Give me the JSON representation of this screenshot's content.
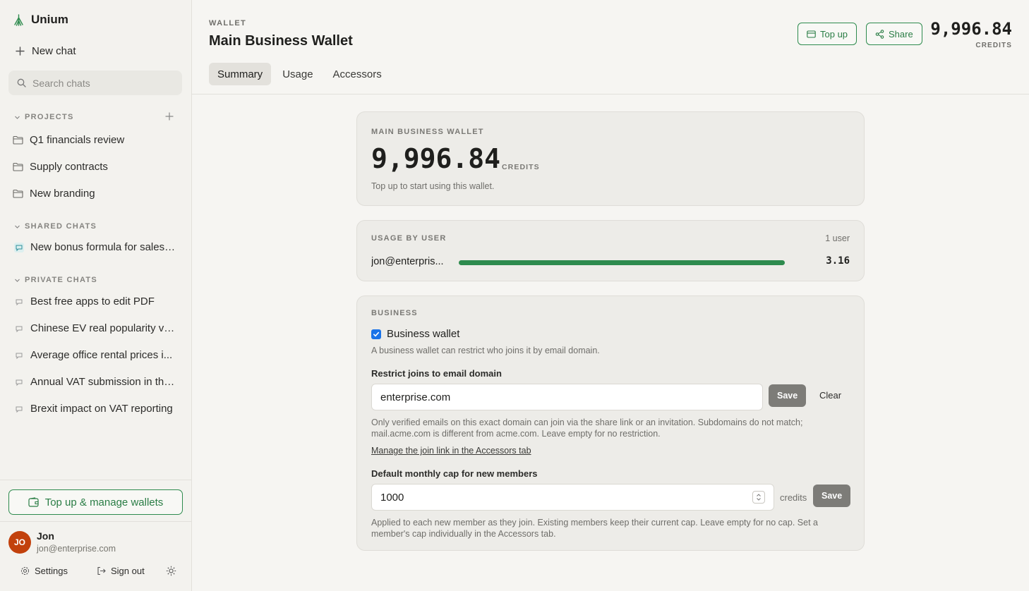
{
  "sidebar": {
    "brand": "Unium",
    "new_chat": "New chat",
    "search_placeholder": "Search chats",
    "projects_heading": "PROJECTS",
    "projects": [
      "Q1 financials review",
      "Supply contracts",
      "New branding"
    ],
    "shared_heading": "SHARED CHATS",
    "shared": [
      "New bonus formula for sales ..."
    ],
    "private_heading": "PRIVATE CHATS",
    "private": [
      "Best free apps to edit PDF",
      "Chinese EV real popularity vs...",
      "Average office rental prices i...",
      "Annual VAT submission in the...",
      "Brexit impact on VAT reporting"
    ],
    "topup_manage": "Top up & manage wallets",
    "user": {
      "initials": "JO",
      "name": "Jon",
      "email": "jon@enterprise.com"
    },
    "settings": "Settings",
    "sign_out": "Sign out"
  },
  "header": {
    "crumb": "WALLET",
    "title": "Main Business Wallet",
    "tabs": [
      "Summary",
      "Usage",
      "Accessors"
    ],
    "active_tab": "Summary",
    "top_up": "Top up",
    "share": "Share",
    "balance": "9,996.84",
    "credits": "CREDITS"
  },
  "balance_card": {
    "label": "MAIN BUSINESS WALLET",
    "balance": "9,996.84",
    "credits": "CREDITS",
    "hint": "Top up to start using this wallet."
  },
  "usage_card": {
    "label": "USAGE BY USER",
    "user_count": "1 user",
    "rows": [
      {
        "email": "jon@enterpris...",
        "value": "3.16",
        "share": 1.0
      }
    ]
  },
  "business_card": {
    "label": "BUSINESS",
    "checkbox_label": "Business wallet",
    "checked": true,
    "checkbox_hint": "A business wallet can restrict who joins it by email domain.",
    "domain_label": "Restrict joins to email domain",
    "domain_value": "enterprise.com",
    "save": "Save",
    "clear": "Clear",
    "domain_help_1": "Only verified emails on this exact domain can join via the share link or an invitation. Subdomains do not match;",
    "domain_help_2": "mail.acme.com is different from acme.com. Leave empty for no restriction.",
    "manage_link": "Manage the join link in the Accessors tab",
    "cap_label": "Default monthly cap for new members",
    "cap_value": "1000",
    "cap_unit": "credits",
    "cap_help_1": "Applied to each new member as they join. Existing members keep their current cap. Leave empty for no cap. Set a",
    "cap_help_2": "member's cap individually in the Accessors tab."
  },
  "colors": {
    "accent": "#2e8b4e",
    "avatar": "#c2410c",
    "checkbox": "#1a73e8"
  }
}
